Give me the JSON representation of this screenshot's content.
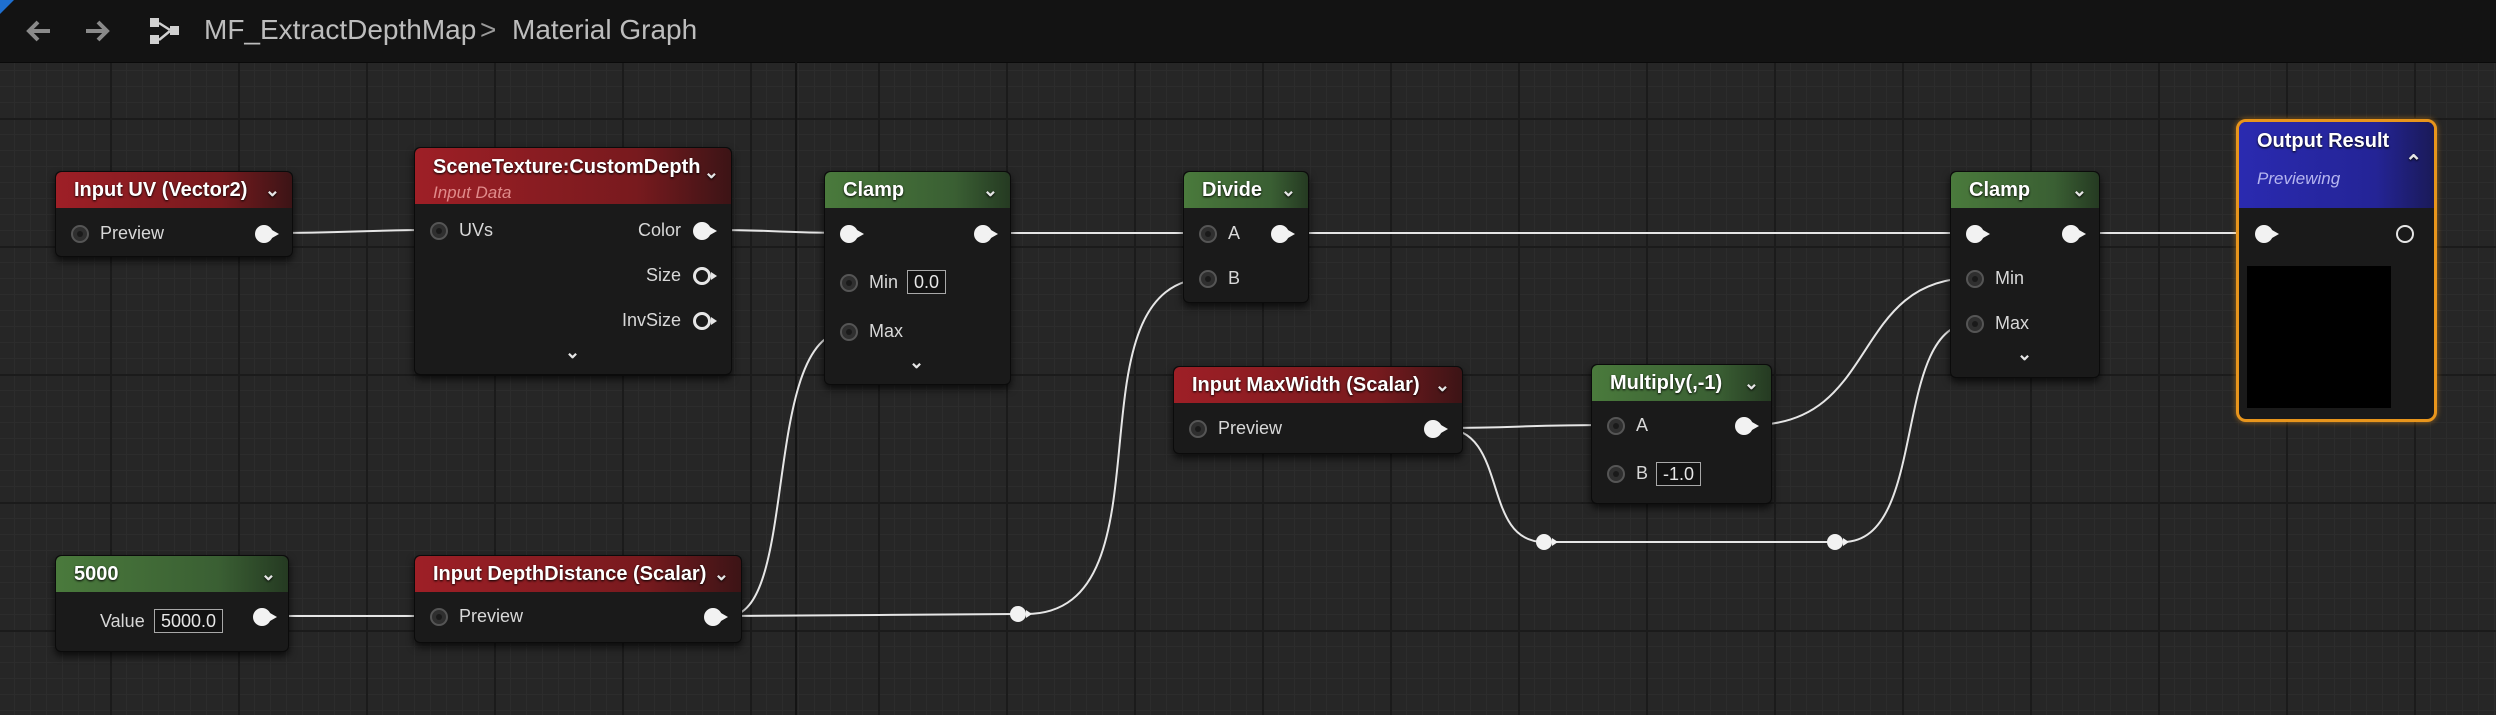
{
  "toolbar": {
    "back_icon": "arrow-left-icon",
    "forward_icon": "arrow-right-icon",
    "graph_icon": "graph-nodes-icon",
    "breadcrumb_asset": "MF_ExtractDepthMap",
    "breadcrumb_sep": ">",
    "breadcrumb_graph": "Material Graph"
  },
  "nodes": {
    "input_uv": {
      "title": "Input UV (Vector2)",
      "preview_label": "Preview"
    },
    "scene_texture": {
      "title": "SceneTexture:CustomDepth",
      "subtitle": "Input Data",
      "uvs_label": "UVs",
      "color_label": "Color",
      "size_label": "Size",
      "invsize_label": "InvSize"
    },
    "clamp1": {
      "title": "Clamp",
      "min_label": "Min",
      "min_value": "0.0",
      "max_label": "Max"
    },
    "divide": {
      "title": "Divide",
      "a_label": "A",
      "b_label": "B"
    },
    "input_maxwidth": {
      "title": "Input MaxWidth (Scalar)",
      "preview_label": "Preview"
    },
    "multiply": {
      "title": "Multiply(,-1)",
      "a_label": "A",
      "b_label": "B",
      "b_value": "-1.0"
    },
    "clamp2": {
      "title": "Clamp",
      "min_label": "Min",
      "max_label": "Max"
    },
    "output": {
      "title": "Output Result",
      "subtitle": "Previewing"
    },
    "constant": {
      "title": "5000",
      "value_label": "Value",
      "value": "5000.0"
    },
    "input_depth": {
      "title": "Input DepthDistance (Scalar)",
      "preview_label": "Preview"
    }
  },
  "colors": {
    "input_header": "#9e1f26",
    "math_header": "#4a7a3c",
    "output_header": "#2a2ab0",
    "selection_outline": "#e8951c",
    "wire": "#e6e6e6"
  }
}
